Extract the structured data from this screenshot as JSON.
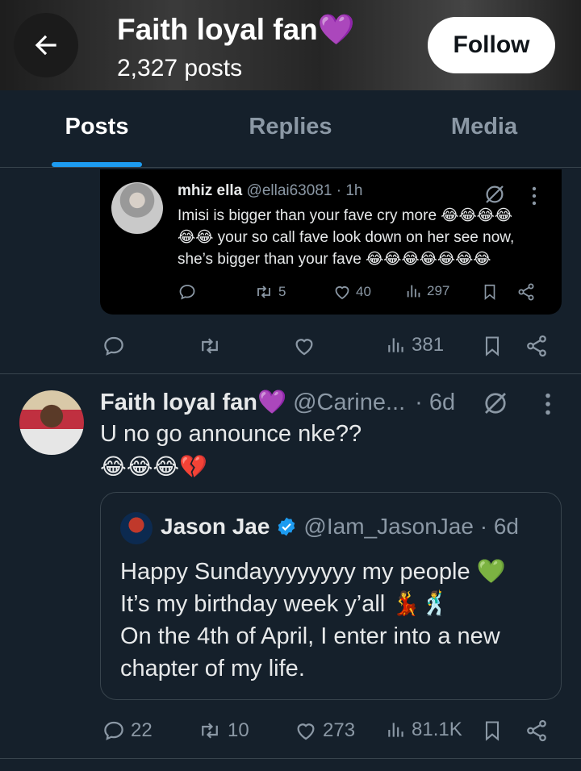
{
  "header": {
    "title": "Faith loyal fan💜",
    "posts_count": "2,327 posts",
    "follow_label": "Follow"
  },
  "tabs": [
    {
      "label": "Posts",
      "active": true
    },
    {
      "label": "Replies",
      "active": false
    },
    {
      "label": "Media",
      "active": false
    }
  ],
  "embedded_post": {
    "name": "mhiz ella",
    "handle": "@ellai63081",
    "time": "· 1h",
    "lines": [
      "Imisi is bigger than your fave cry more 😂😂😂😂",
      "😂😂 your so call fave look down on her see now,",
      "she’s bigger than your fave 😂😂😂😂😂😂😂"
    ],
    "reposts": "5",
    "likes": "40",
    "views": "297"
  },
  "prev_actions": {
    "views": "381"
  },
  "tweet": {
    "name": "Faith loyal fan💜",
    "handle": "@Carine...",
    "time": "· 6d",
    "text": "U no go announce nke??",
    "emoji_line": "😂😂😂💔",
    "quote": {
      "name": "Jason Jae",
      "handle": "@Iam_JasonJae · 6d",
      "lines": [
        "Happy Sundayyyyyyyy my people 💚",
        "It’s my birthday week y’all  💃🕺",
        "On the 4th of April, I enter into a new",
        "chapter of my life."
      ]
    },
    "replies": "22",
    "reposts": "10",
    "likes": "273",
    "views": "81.1K"
  },
  "colors": {
    "background": "#15202b",
    "accent": "#1d9bf0",
    "muted": "#8b98a5",
    "border": "#38444d"
  }
}
